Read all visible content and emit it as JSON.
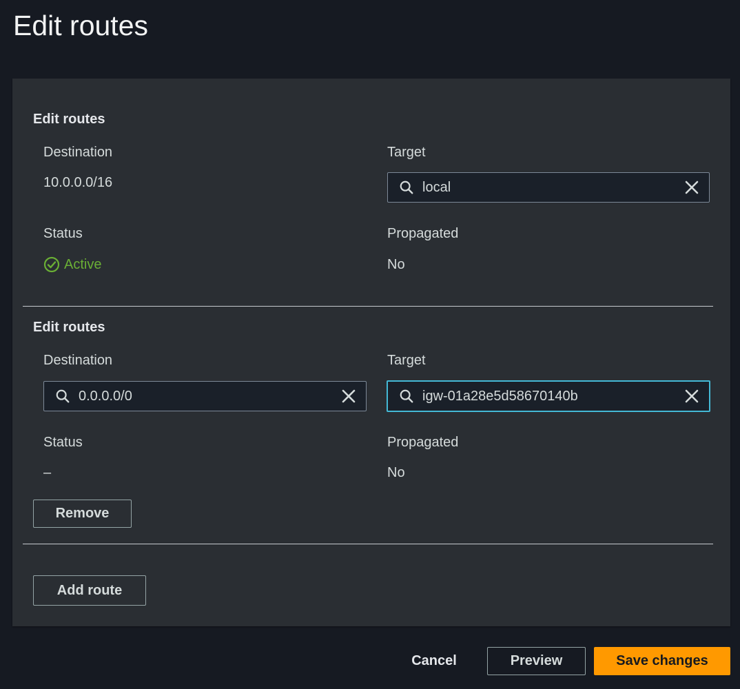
{
  "page": {
    "title": "Edit routes"
  },
  "routes": [
    {
      "section_title": "Edit routes",
      "destination_label": "Destination",
      "destination_value": "10.0.0.0/16",
      "target_label": "Target",
      "target_value": "local",
      "status_label": "Status",
      "status_value": "Active",
      "status_icon": "check-circle-icon",
      "propagated_label": "Propagated",
      "propagated_value": "No"
    },
    {
      "section_title": "Edit routes",
      "destination_label": "Destination",
      "destination_value": "0.0.0.0/0",
      "target_label": "Target",
      "target_value": "igw-01a28e5d58670140b",
      "status_label": "Status",
      "status_value": "–",
      "propagated_label": "Propagated",
      "propagated_value": "No",
      "remove_label": "Remove"
    }
  ],
  "add_route_label": "Add route",
  "footer": {
    "cancel_label": "Cancel",
    "preview_label": "Preview",
    "save_label": "Save changes"
  },
  "colors": {
    "background": "#161a22",
    "panel": "#2a2e33",
    "active_status": "#6aaf35",
    "focus_border": "#44b9d6",
    "primary_button": "#ff9900"
  }
}
